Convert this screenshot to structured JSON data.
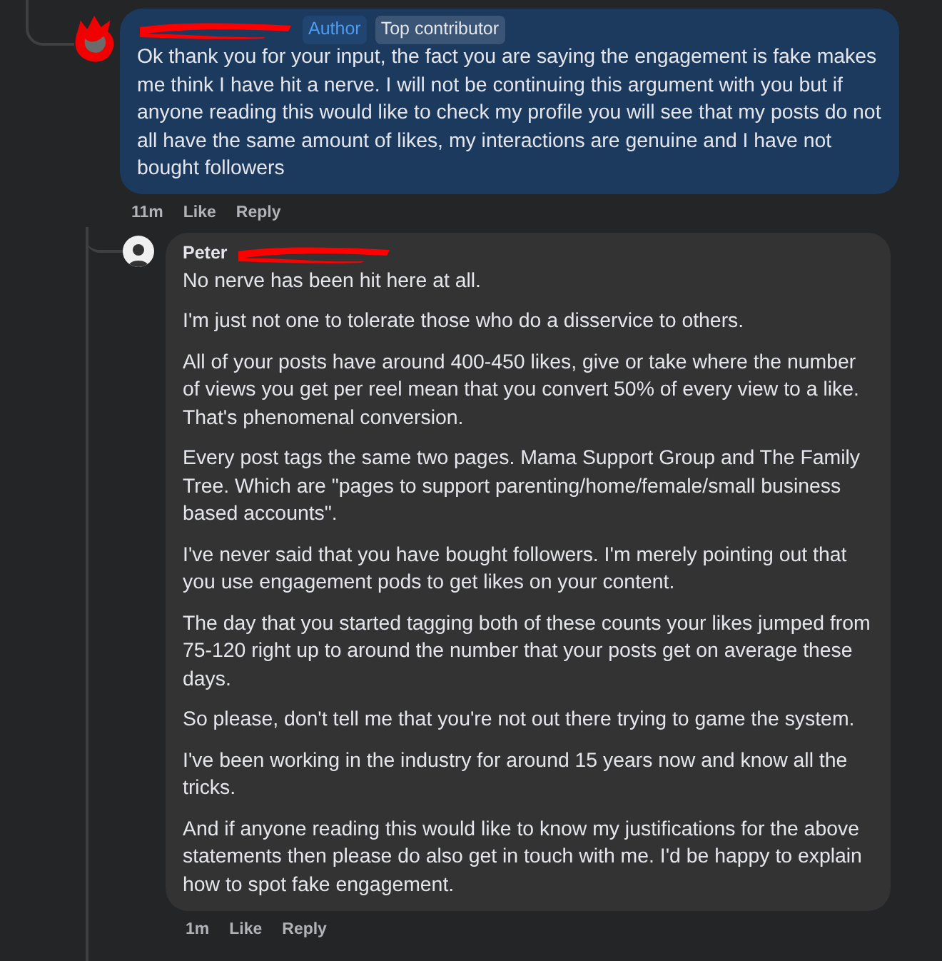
{
  "comments": [
    {
      "name_redacted": true,
      "avatar_redacted": true,
      "badges": [
        {
          "label": "Author",
          "kind": "author"
        },
        {
          "label": "Top contributor",
          "kind": "role"
        }
      ],
      "paragraphs": [
        "Ok thank you for your input, the fact you are saying the engagement is fake makes me think I have hit a nerve. I will not be continuing this argument with you but if anyone reading this would like to check my profile you will see that my posts do not all have the same amount of likes, my interactions are genuine and I have not bought followers"
      ],
      "time": "11m",
      "actions": [
        "Like",
        "Reply"
      ],
      "replies": [
        {
          "author": "Peter",
          "name_redacted": true,
          "paragraphs": [
            "No nerve has been hit here at all.",
            "I'm just not one to tolerate those who do a disservice to others.",
            "All of your posts have around 400-450 likes, give or take where the number of views you get per reel mean that you convert 50% of every view to a like. That's phenomenal conversion.",
            "Every post tags the same two pages. Mama Support Group and The Family Tree. Which are \"pages to support parenting/home/female/small business based accounts\".",
            "I've never said that you have bought followers. I'm merely pointing out that you use engagement pods to get likes on your content.",
            "The day that you started tagging both of these counts your likes jumped from 75-120 right up to around the number that your posts get on average these days.",
            "So please, don't tell me that you're not out there trying to game the system.",
            "I've been working in the industry for around 15 years now and know all the tricks.",
            "And if anyone reading this would like to know my justifications for the above statements then please do also get in touch with me. I'd be happy to explain how to spot fake engagement."
          ],
          "time": "1m",
          "actions": [
            "Like",
            "Reply"
          ]
        }
      ]
    }
  ]
}
